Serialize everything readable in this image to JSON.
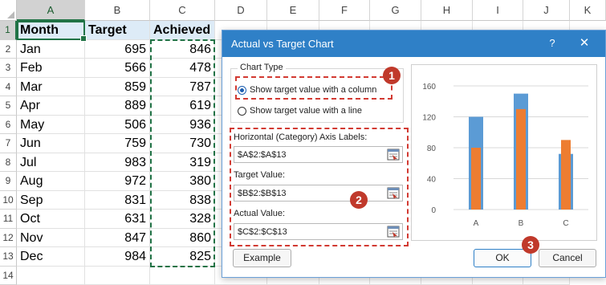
{
  "sheet": {
    "columns": [
      "A",
      "B",
      "C",
      "D",
      "E",
      "F",
      "G",
      "H",
      "I",
      "J",
      "K"
    ],
    "rows": [
      "1",
      "2",
      "3",
      "4",
      "5",
      "6",
      "7",
      "8",
      "9",
      "10",
      "11",
      "12",
      "13",
      "14"
    ],
    "header": [
      "Month",
      "Target",
      "Achieved"
    ],
    "data": [
      [
        "Jan",
        "695",
        "846"
      ],
      [
        "Feb",
        "566",
        "478"
      ],
      [
        "Mar",
        "859",
        "787"
      ],
      [
        "Apr",
        "889",
        "619"
      ],
      [
        "May",
        "506",
        "936"
      ],
      [
        "Jun",
        "759",
        "730"
      ],
      [
        "Jul",
        "983",
        "319"
      ],
      [
        "Aug",
        "972",
        "380"
      ],
      [
        "Sep",
        "831",
        "838"
      ],
      [
        "Oct",
        "631",
        "328"
      ],
      [
        "Nov",
        "847",
        "860"
      ],
      [
        "Dec",
        "984",
        "825"
      ]
    ]
  },
  "dialog": {
    "title": "Actual vs Target Chart",
    "help": "?",
    "close": "✕",
    "chart_type_legend": "Chart Type",
    "options": [
      {
        "label": "Show target value with a column",
        "selected": true
      },
      {
        "label": "Show target value with a line",
        "selected": false
      }
    ],
    "fields": [
      {
        "label": "Horizontal (Category) Axis Labels:",
        "value": "$A$2:$A$13"
      },
      {
        "label": "Target Value:",
        "value": "$B$2:$B$13"
      },
      {
        "label": "Actual Value:",
        "value": "$C$2:$C$13"
      }
    ],
    "badges": [
      "1",
      "2",
      "3"
    ],
    "buttons": {
      "example": "Example",
      "ok": "OK",
      "cancel": "Cancel"
    }
  },
  "colors": {
    "target": "#5b9bd5",
    "actual": "#ed7d31",
    "accent": "#2f80c7",
    "excel_green": "#217346",
    "badge_red": "#c0392b"
  },
  "chart_data": {
    "type": "bar",
    "categories": [
      "A",
      "B",
      "C"
    ],
    "series": [
      {
        "values": [
          120,
          150,
          72
        ]
      },
      {
        "values": [
          80,
          130,
          90
        ]
      }
    ],
    "y_ticks": [
      "0",
      "40",
      "80",
      "120",
      "160"
    ],
    "ylim": [
      0,
      160
    ],
    "grid": true
  }
}
